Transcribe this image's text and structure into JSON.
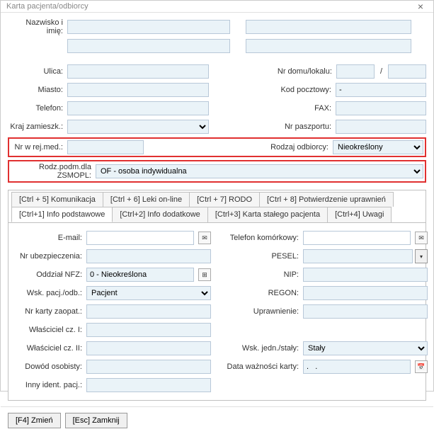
{
  "window": {
    "title": "Karta pacjenta/odbiorcy"
  },
  "top": {
    "name_label": "Nazwisko i imię:",
    "surname": "",
    "firstname": ""
  },
  "addr": {
    "ulica": "Ulica:",
    "miasto": "Miasto:",
    "telefon": "Telefon:",
    "kraj": "Kraj zamieszk.:",
    "nrdomu": "Nr domu/lokalu:",
    "kod": "Kod pocztowy:",
    "kod_val": "-",
    "fax": "FAX:",
    "paszport": "Nr paszportu:"
  },
  "red1": {
    "label": "Nr w rej.med.:",
    "rodzaj_label": "Rodzaj odbiorcy:",
    "rodzaj_val": "Nieokreślony"
  },
  "red2": {
    "label": "Rodz.podm.dla ZSMOPL:",
    "val": "OF - osoba indywidualna"
  },
  "tabs_top": {
    "t5": "[Ctrl + 5] Komunikacja",
    "t6": "[Ctrl + 6] Leki on-line",
    "t7": "[Ctrl + 7] RODO",
    "t8": "[Ctrl + 8] Potwierdzenie uprawnień"
  },
  "tabs_bot": {
    "t1": "[Ctrl+1] Info podstawowe",
    "t2": "[Ctrl+2] Info dodatkowe",
    "t3": "[Ctrl+3] Karta stałego pacjenta",
    "t4": "[Ctrl+4] Uwagi"
  },
  "left": {
    "email": "E-mail:",
    "ubez": "Nr ubezpieczenia:",
    "nfz": "Oddział NFZ:",
    "nfz_val": "0 - Nieokreślona",
    "wsk": "Wsk. pacj./odb.:",
    "wsk_val": "Pacjent",
    "karty": "Nr karty zaopat.:",
    "wl1": "Właściciel cz. I:",
    "wl2": "Właściciel cz. II:",
    "dowod": "Dowód osobisty:",
    "inny": "Inny ident. pacj.:"
  },
  "right": {
    "tel": "Telefon komórkowy:",
    "pesel": "PESEL:",
    "nip": "NIP:",
    "regon": "REGON:",
    "upr": "Uprawnienie:",
    "jedn": "Wsk. jedn./stały:",
    "jedn_val": "Stały",
    "data": "Data ważności karty:",
    "data_val": ".   ."
  },
  "buttons": {
    "zmien": "[F4] Zmień",
    "zamknij": "[Esc] Zamknij"
  }
}
